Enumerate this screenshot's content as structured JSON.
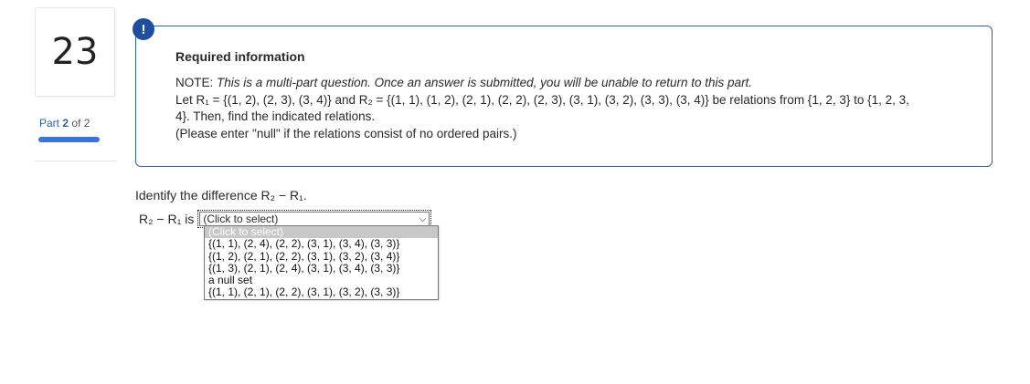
{
  "question": {
    "number": "23"
  },
  "part": {
    "label": "Part",
    "current": "2",
    "of_label": "of",
    "total": "2",
    "progress_fraction": 1.0
  },
  "info": {
    "badge": "!",
    "title": "Required information",
    "note_label": "NOTE:",
    "note_text": "This is a multi-part question. Once an answer is submitted, you will be unable to return to this part.",
    "let_text": "Let R₁ = {(1, 2), (2, 3), (3, 4)} and R₂ = {(1, 1), (1, 2), (2, 1), (2, 2), (2, 3), (3, 1), (3, 2), (3, 3), (3, 4)} be relations from {1, 2, 3} to {1, 2, 3,",
    "let_text2": "4}. Then, find the indicated relations.",
    "hint": "(Please enter \"null\" if the relations consist of no ordered pairs.)"
  },
  "prompt": {
    "text": "Identify the difference R₂ − R₁."
  },
  "answer": {
    "lhs": "R₂ − R₁ is",
    "selected": "(Click to select)",
    "options": [
      "(Click to select)",
      "{(1, 1), (2, 4), (2, 2), (3, 1), (3, 4), (3, 3)}",
      "{(1, 2), (2, 1), (2, 2), (3, 1), (3, 2), (3, 4)}",
      "{(1, 3), (2, 1), (2, 4), (3, 1), (3, 4), (3, 3)}",
      "a null set",
      "{(1, 1), (2, 1), (2, 2), (3, 1), (3, 2), (3, 3)}"
    ]
  },
  "colors": {
    "accent": "#2d63a8",
    "progress": "#3b73d6",
    "badge": "#1f4f9c"
  }
}
